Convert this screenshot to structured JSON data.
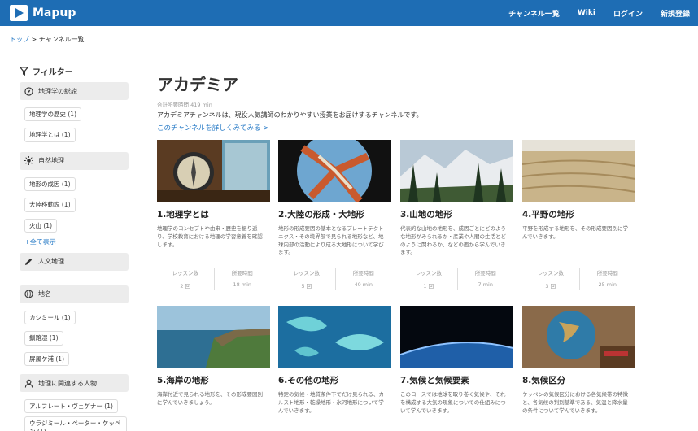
{
  "header": {
    "brand": "Mapup",
    "nav": [
      "チャンネル一覧",
      "Wiki",
      "ログイン",
      "新規登録"
    ]
  },
  "breadcrumb": {
    "home": "トップ",
    "sep": " > ",
    "current": "チャンネル一覧"
  },
  "sidebar": {
    "title": "フィルター",
    "categories": [
      {
        "label": "地理学の総説",
        "icon": "compass-icon",
        "items": [
          "地理学の歴史 (1)",
          "地理学とは (1)"
        ]
      },
      {
        "label": "自然地理",
        "icon": "sun-icon",
        "items": [
          "地形の成因 (1)",
          "大陸移動説 (1)",
          "火山 (1)"
        ],
        "more": "+全て表示"
      },
      {
        "label": "人文地理",
        "icon": "pencil-icon",
        "items": []
      },
      {
        "label": "地名",
        "icon": "globe-icon",
        "items": [
          "カシミール (1)",
          "釧路湿 (1)",
          "屏風ケ浦 (1)"
        ]
      },
      {
        "label": "地理に関連する人物",
        "icon": "person-icon",
        "items": [
          "アルフレート・ヴェゲナー (1)",
          "ウラジミール・ペーター・ケッペン (1)"
        ]
      }
    ]
  },
  "channel": {
    "title": "アカデミア",
    "total_label": "合計所要時間",
    "total_value": "419 min",
    "description": "アカデミアチャンネルは、現役人気講師のわかりやすい授業をお届けするチャンネルです。",
    "link": "このチャンネルを詳しくみてみる >"
  },
  "stat_labels": {
    "lessons": "レッスン数",
    "time": "所要時間"
  },
  "cards": [
    {
      "title": "1.地理学とは",
      "desc": "地理学のコンセプトや由来・歴史を振り返り、学校教育における地理の学習意義を確認します。",
      "lessons": "2 回",
      "time": "18 min"
    },
    {
      "title": "2.大陸の形成・大地形",
      "desc": "地形の形成要因の基本となるプレートテクトニクス・その境界部で見られる地形など、地球内部の活動により成る大地形について学びます。",
      "lessons": "5 回",
      "time": "40 min"
    },
    {
      "title": "3.山地の地形",
      "desc": "代表的な山地の地形を、成因ごとにどのような地形がみられるか・産業や人間の生活とどのように関わるか、などの面から学んでいきます。",
      "lessons": "1 回",
      "time": "7 min"
    },
    {
      "title": "4.平野の地形",
      "desc": "平野を形成する地形を、その形成要因別に学んでいきます。",
      "lessons": "3 回",
      "time": "25 min"
    },
    {
      "title": "5.海岸の地形",
      "desc": "海岸付近で見られる地形を、その形成要因別に学んでいきましょう。"
    },
    {
      "title": "6.その他の地形",
      "desc": "特定の気候・地質条件下でだけ見られる、カルスト地形・乾燥地形・氷河地形について学んでいきます。"
    },
    {
      "title": "7.気候と気候要素",
      "desc": "このコースでは地球を取り巻く気候や、それを構成する大気の現象についての仕組みについて学んでいきます。"
    },
    {
      "title": "8.気候区分",
      "desc": "ケッペンの気候区分における各気候帯の特徴と、各気候の判別基準である、気温と降水量の条件について学んでいきます。"
    }
  ]
}
